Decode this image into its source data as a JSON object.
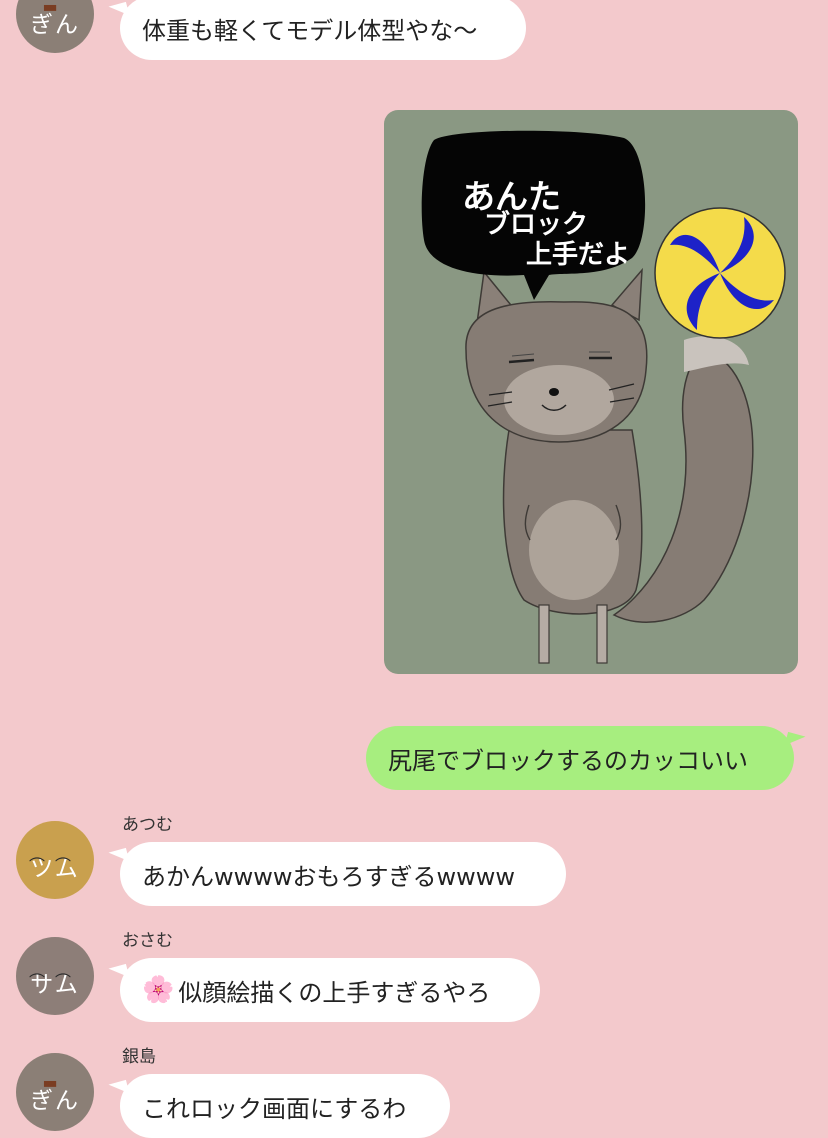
{
  "messages": {
    "m1": {
      "avatar": "ぎん",
      "text": "体重も軽くてモデル体型やな〜"
    },
    "sticker": {
      "bubble_line1": "あんた",
      "bubble_line2": "ブロック",
      "bubble_line3": "上手だよ"
    },
    "m2": {
      "text": "尻尾でブロックするのカッコいい"
    },
    "m3": {
      "sender": "あつむ",
      "avatar": "ツム",
      "text": "あかんwwwwおもろすぎるwwww"
    },
    "m4": {
      "sender": "おさむ",
      "avatar": "サム",
      "emoji": "🌸",
      "text": "似顔絵描くの上手すぎるやろ"
    },
    "m5": {
      "sender": "銀島",
      "avatar": "ぎん",
      "text": "これロック画面にするわ"
    }
  },
  "colors": {
    "background": "#f3c9cc",
    "incoming_bubble": "#ffffff",
    "outgoing_bubble": "#a7ee7f",
    "avatar_gin": "#8b7f76",
    "avatar_tsumu": "#c9a04e",
    "avatar_samu": "#8d7e78",
    "sticker_bg": "#8a9883"
  },
  "icons": {
    "flower": "cherry-blossom-icon",
    "ball": "volleyball-icon",
    "character": "fox-character-icon"
  }
}
